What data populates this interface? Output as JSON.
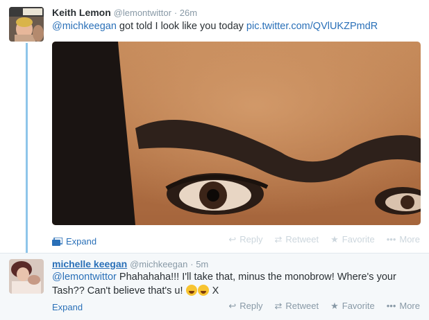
{
  "tweets": [
    {
      "fullname": "Keith Lemon",
      "username": "@lemontwittor",
      "time": "· 26m",
      "mention": "@michkeegan",
      "text": " got told I look like you today ",
      "link": "pic.twitter.com/QVlUKZPmdR",
      "expand_label": "Expand",
      "actions": {
        "reply": "Reply",
        "retweet": "Retweet",
        "favorite": "Favorite",
        "more": "More"
      }
    },
    {
      "fullname": "michelle keegan",
      "username": "@michkeegan",
      "time": "· 5m",
      "mention": "@lemontwittor",
      "text": " Phahahaha!!! I'll take that, minus the monobrow! Where's your Tash?? Can't believe that's u! ",
      "text_tail": " X",
      "expand_label": "Expand",
      "actions": {
        "reply": "Reply",
        "retweet": "Retweet",
        "favorite": "Favorite",
        "more": "More"
      }
    }
  ],
  "icons": {
    "reply": "reply-arrow-icon",
    "retweet": "retweet-icon",
    "favorite": "star-icon",
    "more": "ellipsis-icon",
    "expand": "photo-expand-icon",
    "emoji": "face-with-tears-of-joy-emoji"
  },
  "colors": {
    "link": "#2a70b8",
    "thread_line": "#8ec5ea",
    "meta": "#8899a6",
    "reply_bg": "#f5f8fa"
  }
}
